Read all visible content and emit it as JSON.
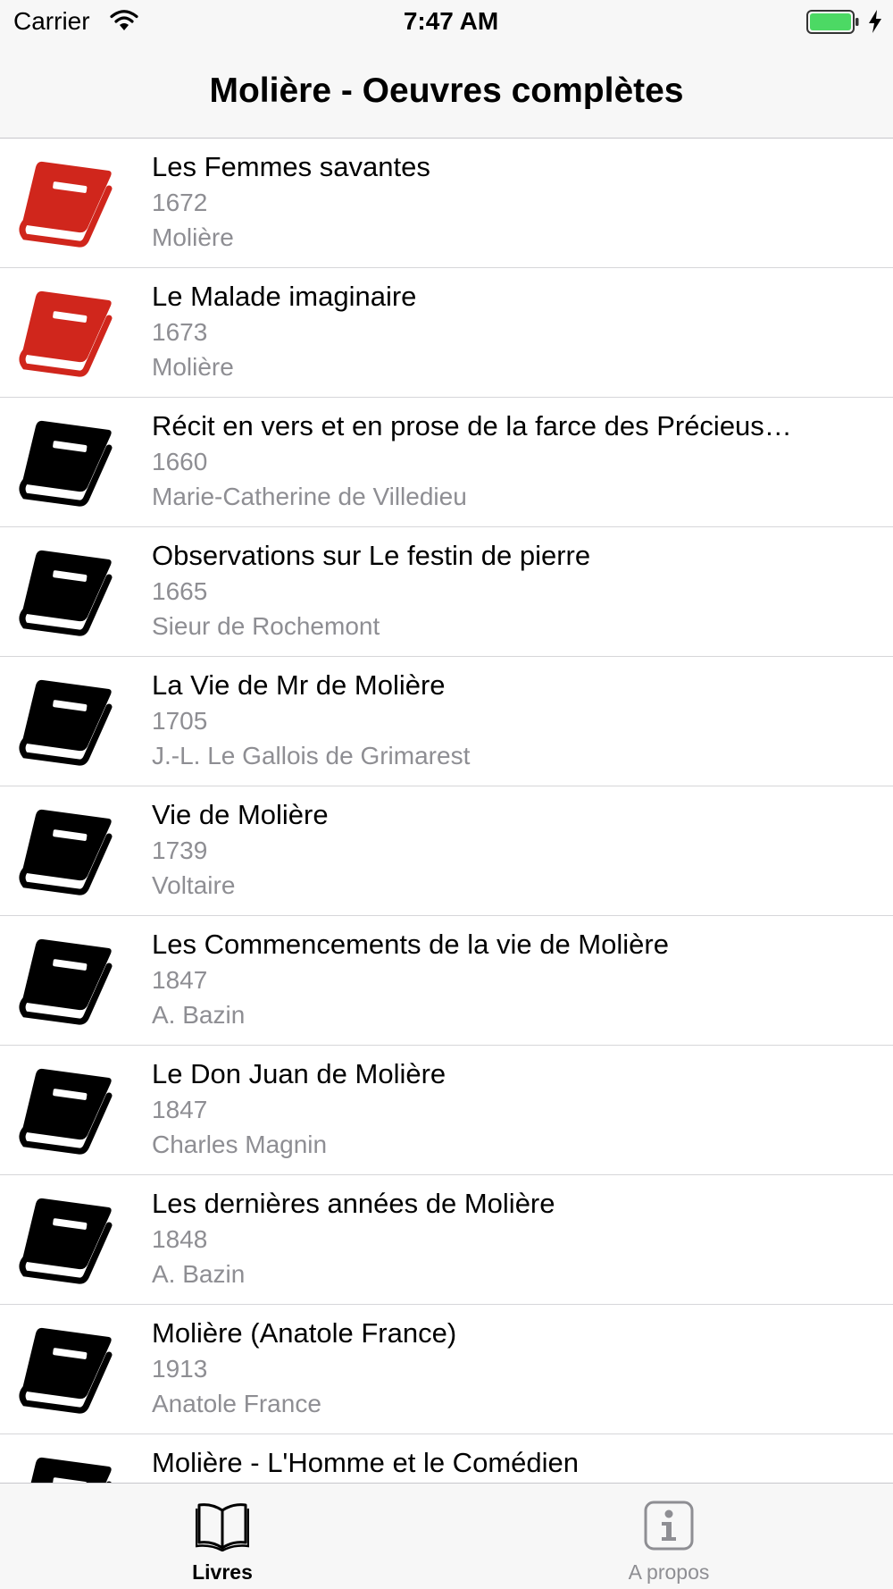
{
  "status_bar": {
    "carrier": "Carrier",
    "time": "7:47 AM"
  },
  "nav": {
    "title": "Molière - Oeuvres complètes"
  },
  "colors": {
    "red_book": "#d0261c",
    "black_book": "#000000",
    "secondary_text": "#8e8e93",
    "battery_fill": "#4cd964"
  },
  "books": [
    {
      "title": "Les Femmes savantes",
      "year": "1672",
      "author": "Molière",
      "icon": "book-icon-red"
    },
    {
      "title": "Le Malade imaginaire",
      "year": "1673",
      "author": "Molière",
      "icon": "book-icon-red"
    },
    {
      "title": "Récit en vers et en prose de la farce des Précieus…",
      "year": "1660",
      "author": "Marie-Catherine de Villedieu",
      "icon": "book-icon-black"
    },
    {
      "title": "Observations sur Le festin de pierre",
      "year": "1665",
      "author": "Sieur de Rochemont",
      "icon": "book-icon-black"
    },
    {
      "title": "La Vie de Mr de Molière",
      "year": "1705",
      "author": "J.-L. Le Gallois de Grimarest",
      "icon": "book-icon-black"
    },
    {
      "title": "Vie de Molière",
      "year": "1739",
      "author": "Voltaire",
      "icon": "book-icon-black"
    },
    {
      "title": "Les Commencements de la vie de Molière",
      "year": "1847",
      "author": "A. Bazin",
      "icon": "book-icon-black"
    },
    {
      "title": "Le Don Juan de Molière",
      "year": "1847",
      "author": "Charles Magnin",
      "icon": "book-icon-black"
    },
    {
      "title": "Les dernières années de Molière",
      "year": "1848",
      "author": "A. Bazin",
      "icon": "book-icon-black"
    },
    {
      "title": "Molière (Anatole France)",
      "year": "1913",
      "author": "Anatole France",
      "icon": "book-icon-black"
    },
    {
      "title": "Molière - L'Homme et le Comédien",
      "year": "",
      "author": "",
      "icon": "book-icon-black"
    }
  ],
  "tabs": [
    {
      "label": "Livres",
      "icon": "open-book-icon",
      "selected": true
    },
    {
      "label": "A propos",
      "icon": "info-icon",
      "selected": false
    }
  ]
}
